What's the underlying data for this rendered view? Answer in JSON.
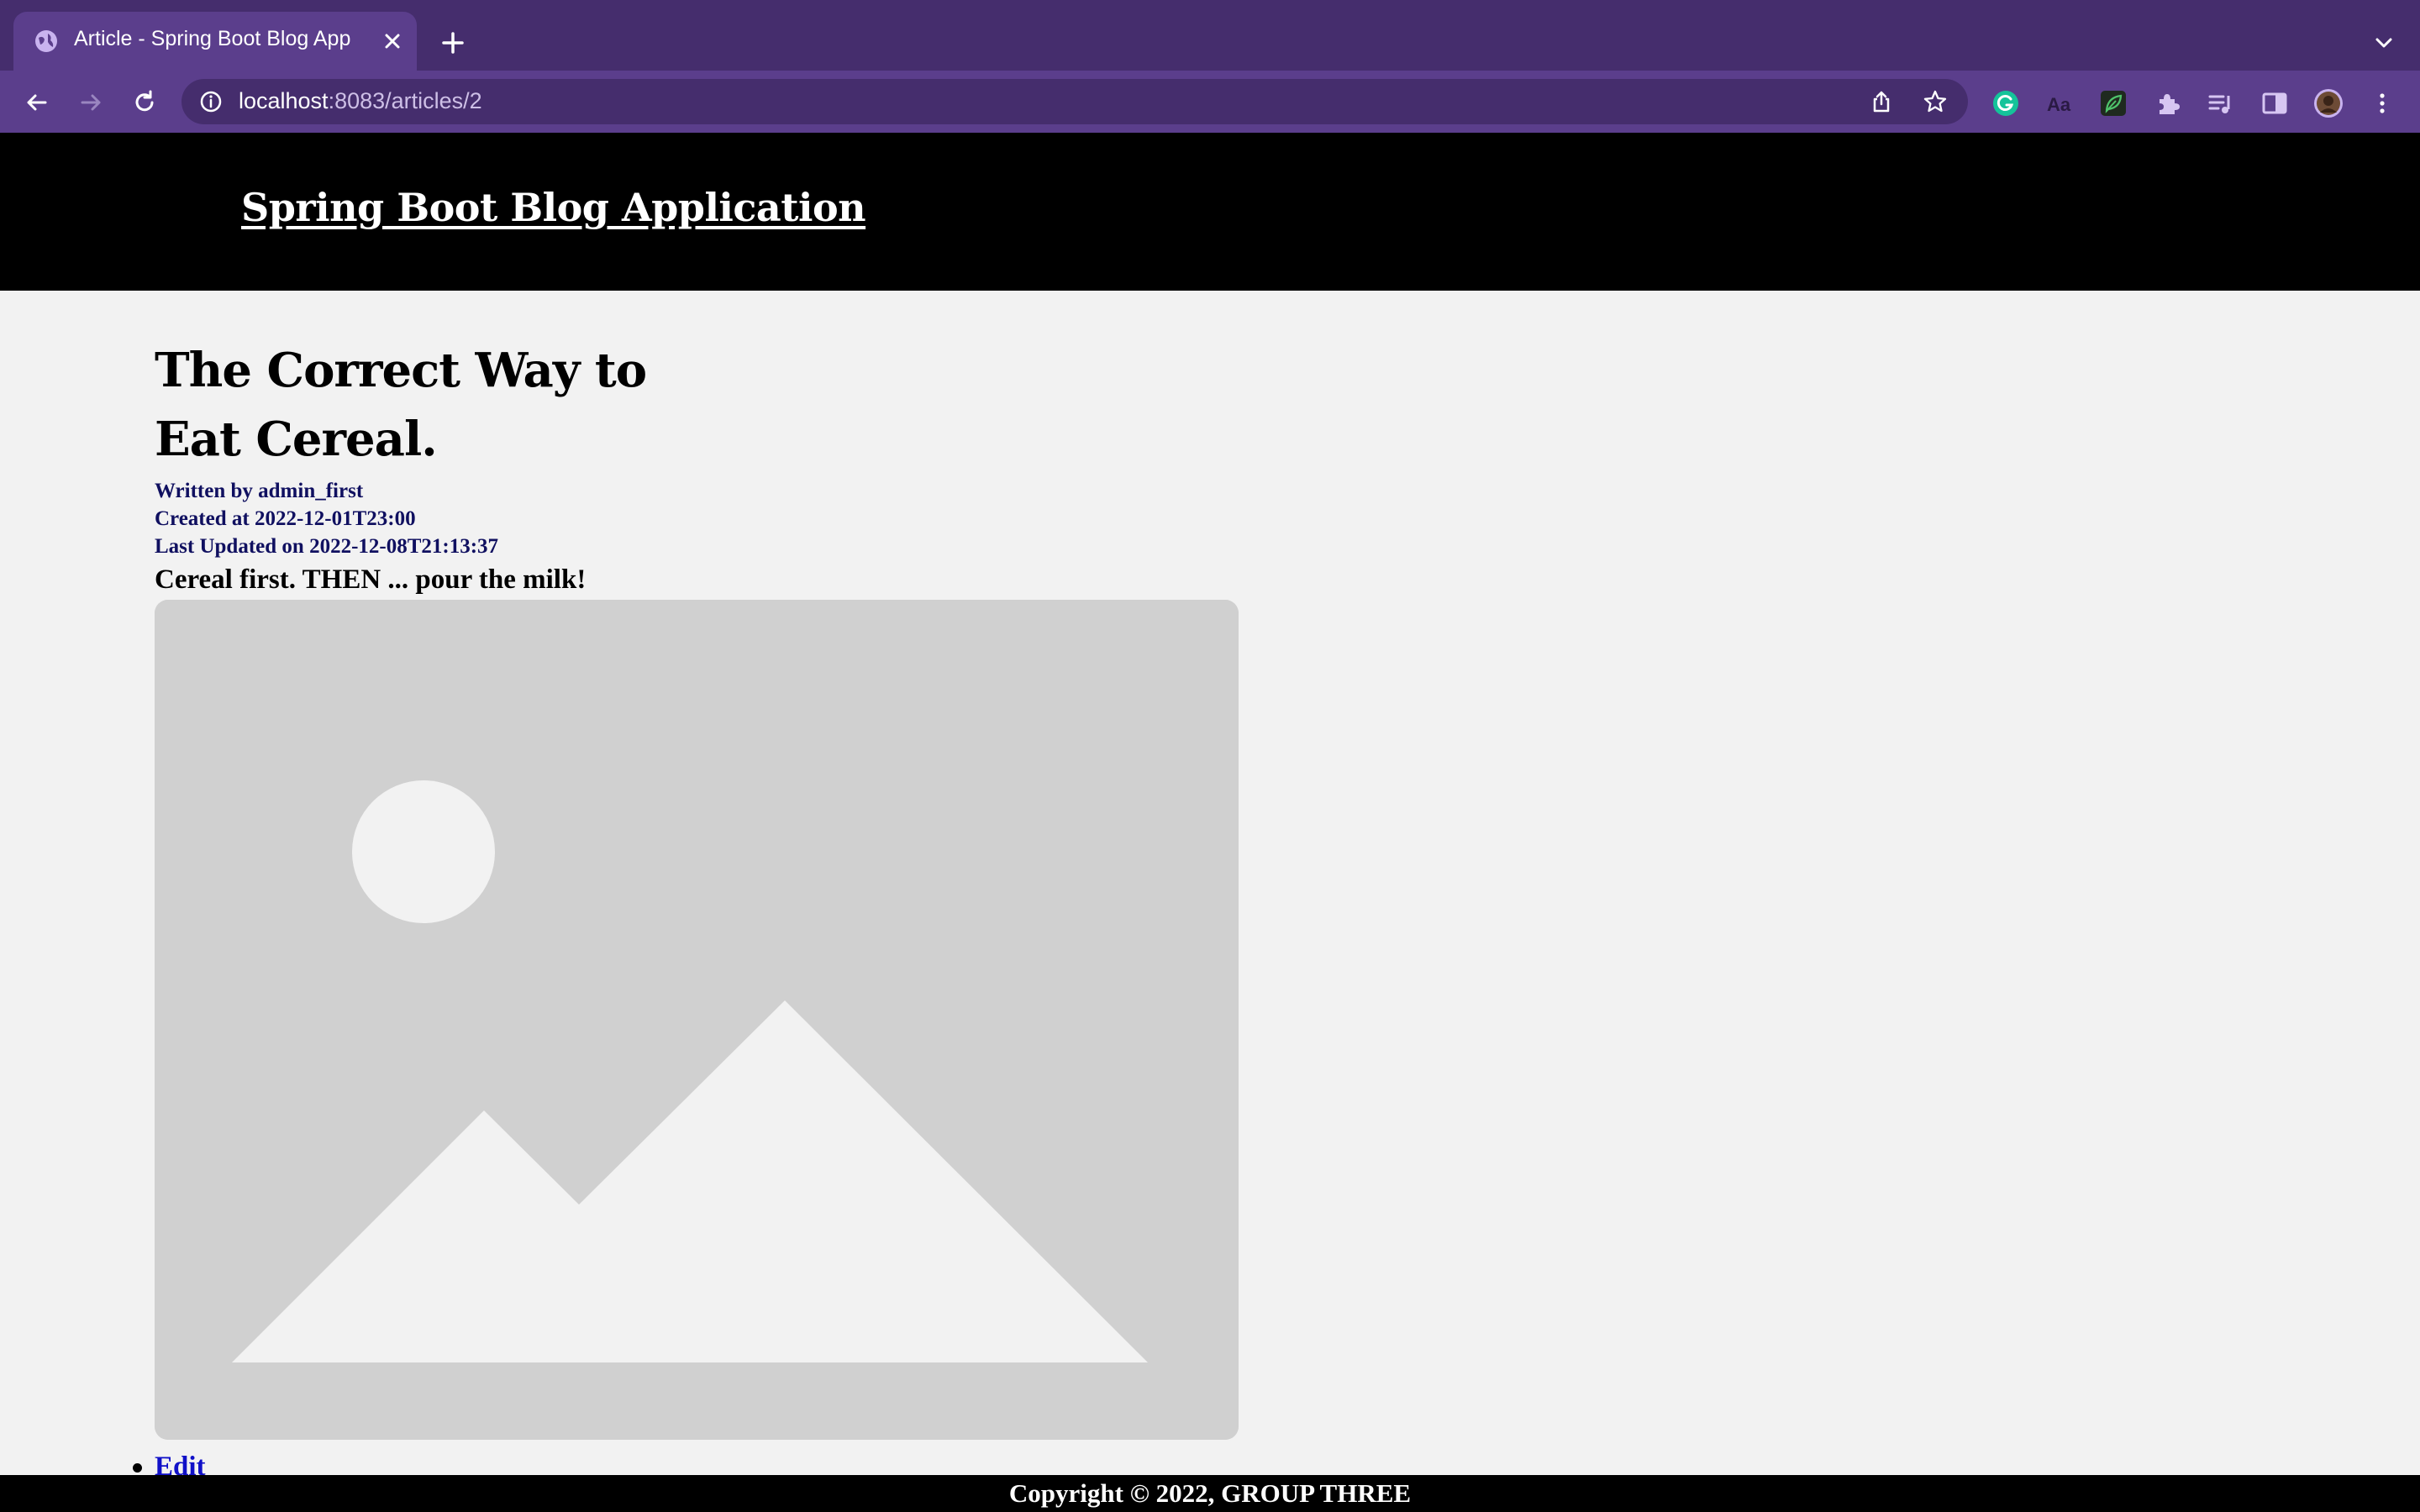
{
  "browser": {
    "tab_title": "Article - Spring Boot Blog App",
    "url_host": "localhost",
    "url_rest": ":8083/articles/2",
    "colors": {
      "tabstrip": "#452d6d",
      "toolbar": "#5b3e8c"
    }
  },
  "header": {
    "site_title": "Spring Boot Blog Application"
  },
  "article": {
    "title": "The Correct Way to Eat Cereal.",
    "author_line": "Written by admin_first",
    "created_line": "Created at 2022-12-01T23:00",
    "updated_line": "Last Updated on 2022-12-08T21:13:37",
    "body": "Cereal first. THEN ... pour the milk!",
    "image_icon": "image-placeholder-icon"
  },
  "actions": {
    "edit_label": "Edit"
  },
  "footer": {
    "copyright": "Copyright © 2022, GROUP THREE"
  }
}
